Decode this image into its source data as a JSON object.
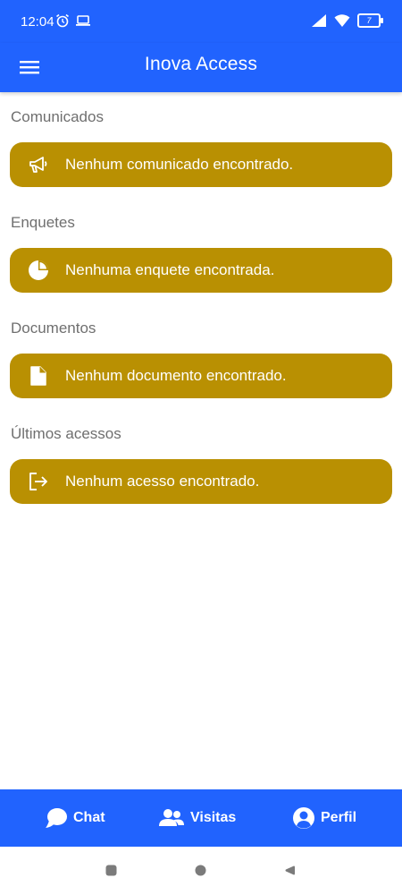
{
  "status_bar": {
    "time": "12:04",
    "battery": "7"
  },
  "app_bar": {
    "title": "Inova Access"
  },
  "sections": [
    {
      "title": "Comunicados",
      "message": "Nenhum comunicado encontrado.",
      "icon": "megaphone-icon"
    },
    {
      "title": "Enquetes",
      "message": "Nenhuma enquete encontrada.",
      "icon": "pie-chart-icon"
    },
    {
      "title": "Documentos",
      "message": "Nenhum documento encontrado.",
      "icon": "file-icon"
    },
    {
      "title": "Últimos acessos",
      "message": "Nenhum acesso encontrado.",
      "icon": "sign-out-icon"
    }
  ],
  "bottom_nav": {
    "chat": "Chat",
    "visitas": "Visitas",
    "perfil": "Perfil"
  },
  "colors": {
    "primary": "#2163fe",
    "card": "#b99002",
    "section_title": "#6f6f6f"
  }
}
